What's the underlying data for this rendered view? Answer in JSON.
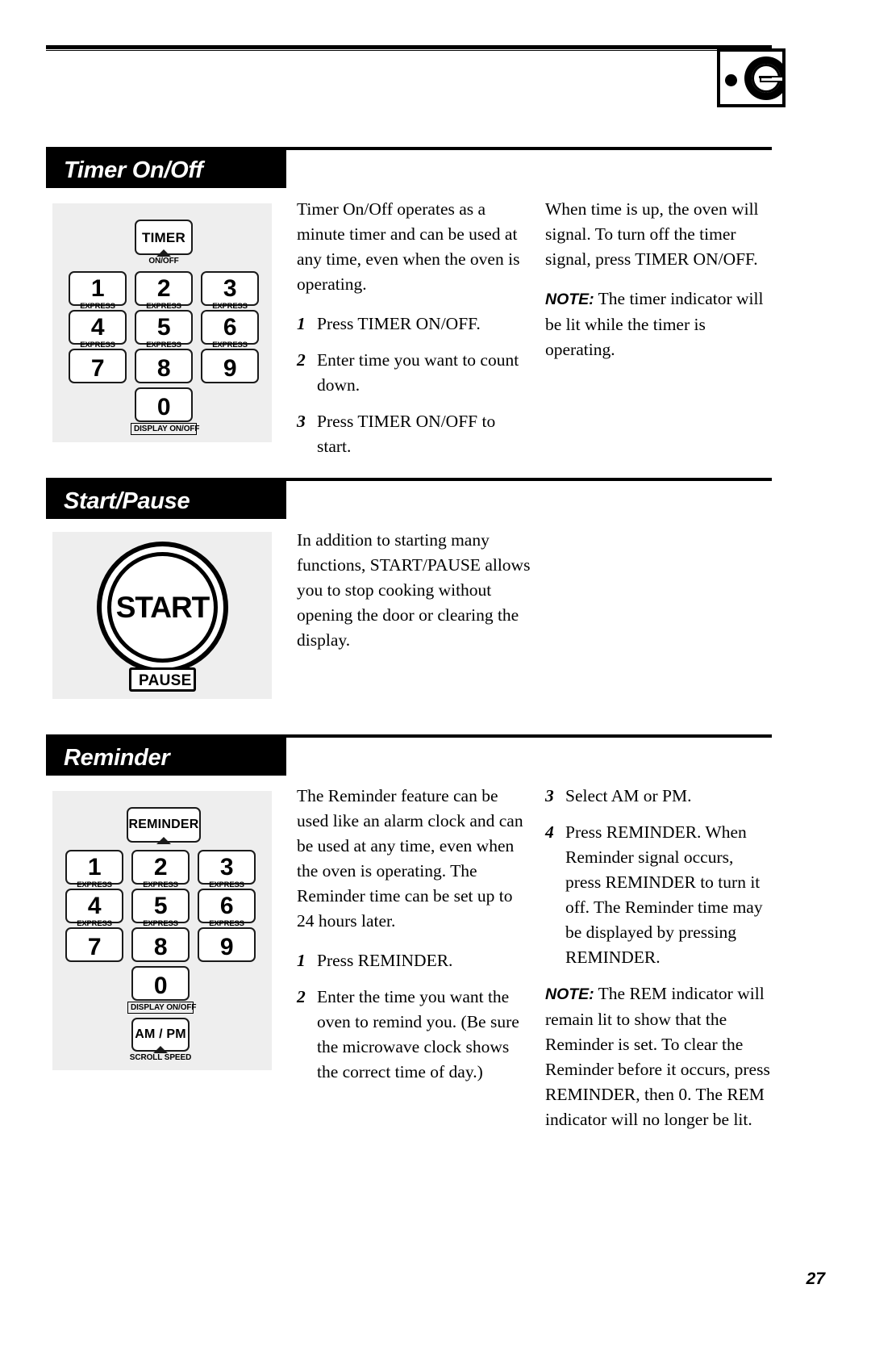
{
  "page": {
    "number": "27",
    "brand_logo": "ge-monogram-logo"
  },
  "sections": [
    {
      "id": "timer-on-off",
      "title": "Timer On/Off",
      "keypad": {
        "function_key": {
          "label": "TIMER",
          "caption": "ON/OFF"
        },
        "keys": [
          {
            "num": "1",
            "sub": "EXPRESS COOK"
          },
          {
            "num": "2",
            "sub": "EXPRESS COOK"
          },
          {
            "num": "3",
            "sub": "EXPRESS COOK"
          },
          {
            "num": "4",
            "sub": "EXPRESS COOK"
          },
          {
            "num": "5",
            "sub": "EXPRESS COOK"
          },
          {
            "num": "6",
            "sub": "EXPRESS COOK"
          },
          {
            "num": "7",
            "sub": ""
          },
          {
            "num": "8",
            "sub": ""
          },
          {
            "num": "9",
            "sub": ""
          },
          {
            "num": "0",
            "sub": ""
          }
        ],
        "zero_caption": "DISPLAY ON/OFF"
      },
      "col1": {
        "intro": "Timer On/Off operates as a minute timer and can be used at any time, even when the oven is operating.",
        "steps": [
          {
            "n": "1",
            "text": "Press TIMER ON/OFF."
          },
          {
            "n": "2",
            "text": "Enter time you want to count down."
          },
          {
            "n": "3",
            "text": "Press TIMER ON/OFF to start."
          }
        ]
      },
      "col2": {
        "para": "When time is up, the oven will signal. To turn off the timer signal, press TIMER ON/OFF.",
        "note_label": "NOTE:",
        "note_text": " The timer indicator will be lit while the timer is operating."
      }
    },
    {
      "id": "start-pause",
      "title": "Start/Pause",
      "keypad": {
        "start_label": "START",
        "pause_label": "PAUSE"
      },
      "col1": {
        "intro": "In addition to starting many functions, START/PAUSE allows you to stop cooking without opening the door or clearing the display."
      }
    },
    {
      "id": "reminder",
      "title": "Reminder",
      "keypad": {
        "function_key": {
          "label": "REMINDER",
          "caption": ""
        },
        "keys": [
          {
            "num": "1",
            "sub": "EXPRESS COOK"
          },
          {
            "num": "2",
            "sub": "EXPRESS COOK"
          },
          {
            "num": "3",
            "sub": "EXPRESS COOK"
          },
          {
            "num": "4",
            "sub": "EXPRESS COOK"
          },
          {
            "num": "5",
            "sub": "EXPRESS COOK"
          },
          {
            "num": "6",
            "sub": "EXPRESS COOK"
          },
          {
            "num": "7",
            "sub": ""
          },
          {
            "num": "8",
            "sub": ""
          },
          {
            "num": "9",
            "sub": ""
          },
          {
            "num": "0",
            "sub": ""
          }
        ],
        "zero_caption": "DISPLAY ON/OFF",
        "ampm_label": "AM / PM",
        "ampm_caption": "SCROLL SPEED"
      },
      "col1": {
        "intro": "The Reminder feature can be used like an alarm clock and can be used at any time, even when the oven is operating. The Reminder time can be set up to 24 hours later.",
        "steps": [
          {
            "n": "1",
            "text": "Press REMINDER."
          },
          {
            "n": "2",
            "text": "Enter the time you want the oven to remind you. (Be sure the microwave clock shows the correct time of day.)"
          }
        ]
      },
      "col2": {
        "steps": [
          {
            "n": "3",
            "text": "Select AM or PM."
          },
          {
            "n": "4",
            "text": "Press REMINDER. When Reminder signal occurs, press REMINDER to turn it off. The Reminder time may be displayed by pressing REMINDER."
          }
        ],
        "note_label": "NOTE:",
        "note_text": " The REM indicator will remain lit to show that the Reminder is set. To clear the Reminder before it occurs, press REMINDER, then 0. The REM indicator will no longer be lit."
      }
    }
  ]
}
